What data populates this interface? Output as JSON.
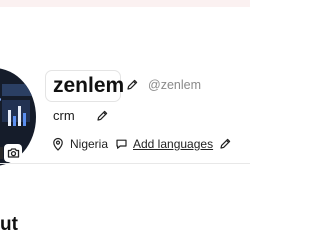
{
  "profile": {
    "name": "zenlem",
    "handle": "@zenlem",
    "bio": "crm",
    "location": "Nigeria",
    "languages_link": "Add languages"
  },
  "section": {
    "heading": "ut"
  },
  "icons": {
    "edit": "pencil-icon",
    "location": "map-pin-icon",
    "languages": "speech-bubble-icon",
    "camera": "camera-icon"
  }
}
